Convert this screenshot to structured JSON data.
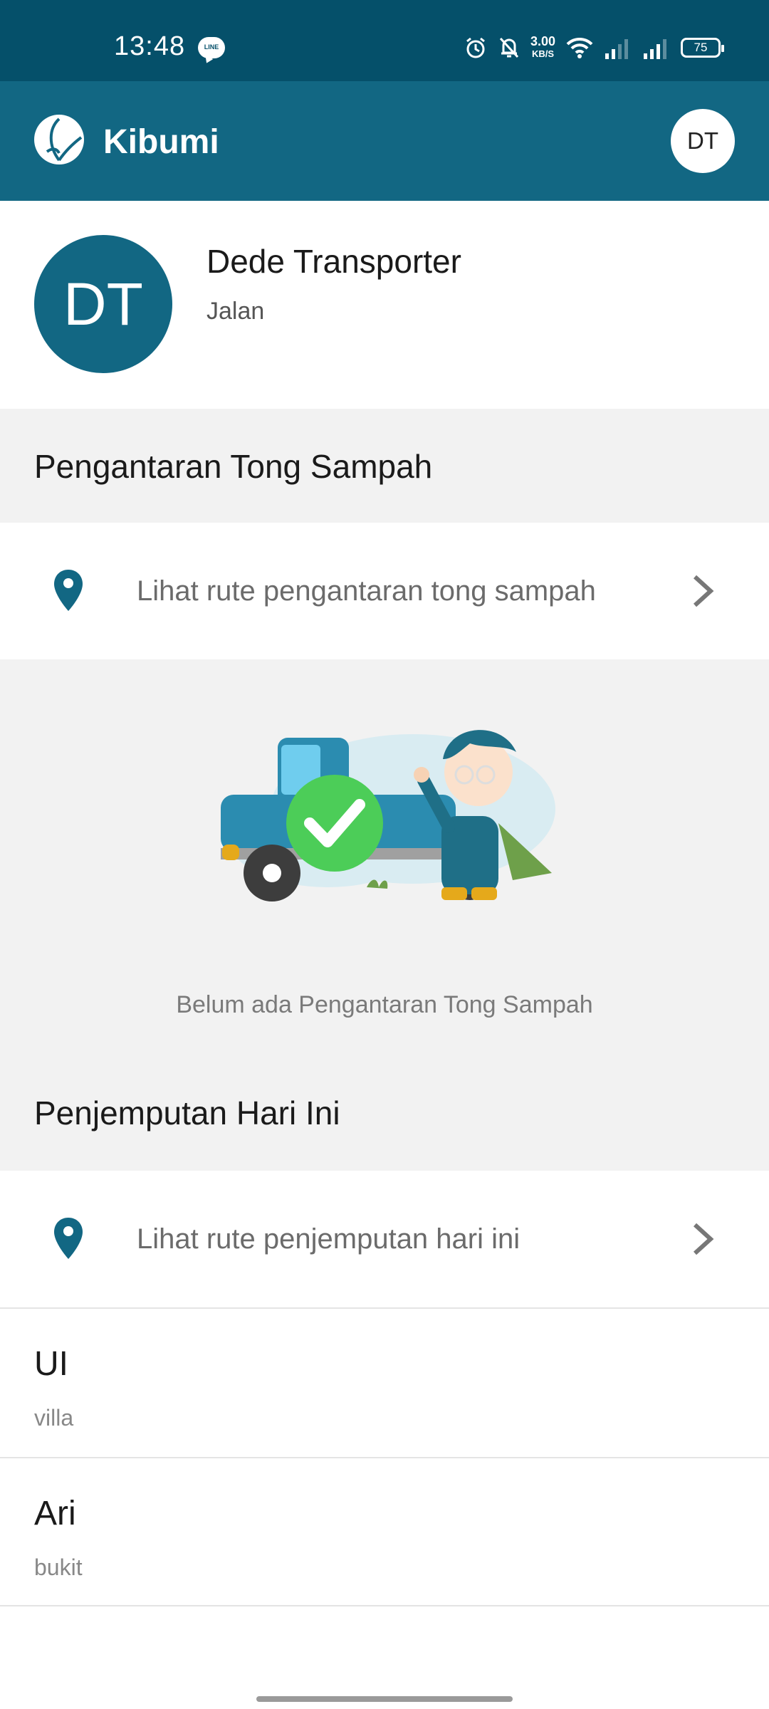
{
  "status_bar": {
    "time": "13:48",
    "speed_value": "3.00",
    "speed_unit": "KB/S",
    "battery": "75"
  },
  "app_bar": {
    "title": "Kibumi",
    "avatar_initials": "DT",
    "brand_color": "#126783"
  },
  "profile": {
    "initials": "DT",
    "name": "Dede Transporter",
    "address": "Jalan"
  },
  "delivery": {
    "section_title": "Pengantaran Tong Sampah",
    "route_label": "Lihat rute pengantaran tong sampah",
    "empty_text": "Belum ada Pengantaran Tong Sampah"
  },
  "pickup": {
    "section_title": "Penjemputan Hari Ini",
    "route_label": "Lihat rute penjemputan hari ini",
    "items": [
      {
        "name": "UI",
        "area": "villa"
      },
      {
        "name": "Ari",
        "area": "bukit"
      }
    ]
  },
  "icons": {
    "location": "map-pin-icon",
    "chevron": "chevron-right-icon",
    "logo": "kibumi-leaf-logo"
  }
}
